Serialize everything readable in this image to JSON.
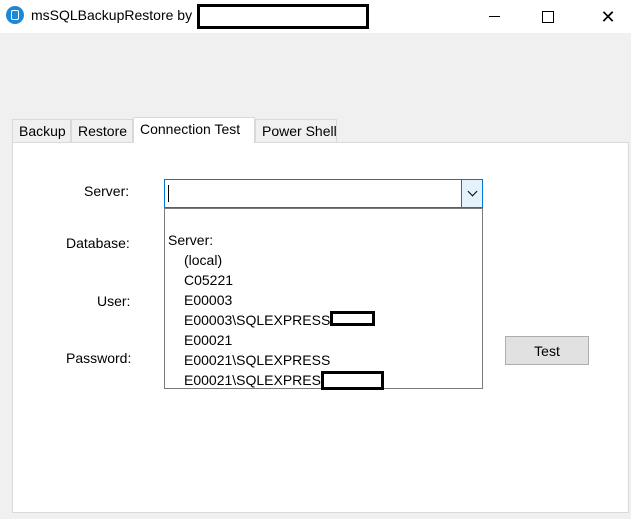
{
  "window": {
    "title": "msSQLBackupRestore by",
    "icon": "database-app-icon",
    "controls": {
      "minimize": "minimize-icon",
      "maximize": "maximize-icon",
      "close": "close-icon",
      "close_glyph": "✕"
    }
  },
  "tabs": [
    {
      "label": "Backup"
    },
    {
      "label": "Restore"
    },
    {
      "label": "Connection Test",
      "active": true
    },
    {
      "label": "Power Shell"
    }
  ],
  "form": {
    "server_label": "Server:",
    "database_label": "Database:",
    "user_label": "User:",
    "password_label": "Password:",
    "server_value": "",
    "test_button": "Test"
  },
  "dropdown": {
    "header": "Server:",
    "items": [
      {
        "label": "(local)"
      },
      {
        "label": "C05221"
      },
      {
        "label": "E00003"
      },
      {
        "label": "E00003\\SQLEXPRESSE"
      },
      {
        "label": "E00021"
      },
      {
        "label": "E00021\\SQLEXPRESS"
      },
      {
        "label": "E00021\\SQLEXPRESS"
      }
    ]
  },
  "colors": {
    "focus_border": "#0078d7",
    "window_bg": "#f0f0f0",
    "panel_bg": "#ffffff"
  }
}
